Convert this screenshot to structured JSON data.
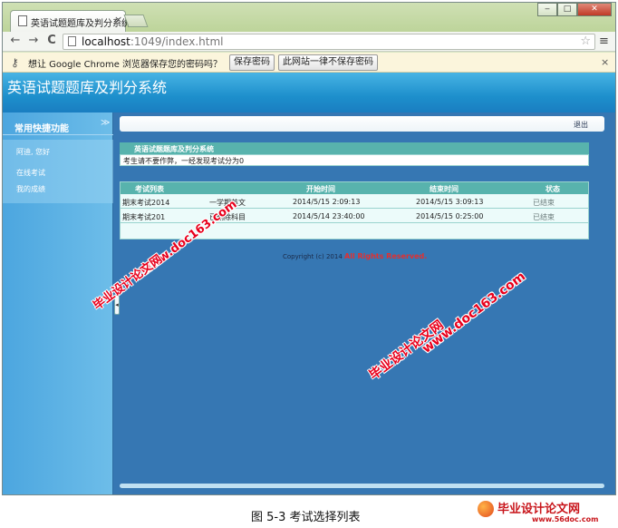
{
  "browser": {
    "tab_title": "英语试题题库及判分系统",
    "tab_close": "×",
    "window_buttons": {
      "minimize": "‒",
      "maximize": "□",
      "close": "✕"
    },
    "nav": {
      "back": "←",
      "forward": "→",
      "reload": "C"
    },
    "url_host": "localhost",
    "url_path": ":1049/index.html",
    "star": "☆",
    "menu": "≡",
    "infobar": {
      "text": "想让 Google Chrome 浏览器保存您的密码吗？",
      "save_button": "保存密码",
      "never_button": "此网站一律不保存密码",
      "close": "×"
    }
  },
  "app": {
    "title": "英语试题题库及判分系统",
    "sidebar": {
      "header": "常用快捷功能",
      "chevron": "≫",
      "items": [
        {
          "label": "阿迪, 您好"
        },
        {
          "label": "在线考试"
        },
        {
          "label": "我的成绩"
        }
      ],
      "collapse": "◂"
    },
    "topbar": {
      "logout": "退出"
    },
    "panel": {
      "title": "英语试题题库及判分系统",
      "notice": "考生请不要作弊，一经发现考试分为0"
    },
    "exam_table": {
      "headers": [
        "考试列表",
        "",
        "开始时间",
        "结束时间",
        "状态"
      ],
      "rows": [
        {
          "name": "期末考试2014",
          "subject": "一学期英文",
          "start": "2014/5/15 2:09:13",
          "end": "2014/5/15 3:09:13",
          "status": "已结束"
        },
        {
          "name": "期末考试201",
          "subject": "已删除科目",
          "start": "2014/5/14 23:40:00",
          "end": "2014/5/15 0:25:00",
          "status": "已结束"
        }
      ]
    },
    "copyright_prefix": "Copyright (c) 2014",
    "copyright_suffix": "All Rights Reserved."
  },
  "watermarks": {
    "site": "www.doc163.com",
    "brand": "毕业设计论文网"
  },
  "caption": "图 5-3 考试选择列表",
  "footer_logo": {
    "name": "毕业设计论文网",
    "url": "www.56doc.com"
  },
  "colors": {
    "watermark": "#e8001c",
    "header": "#1d8fcc",
    "table_header": "#58b3ad",
    "viewport_bg": "#3677b3"
  }
}
